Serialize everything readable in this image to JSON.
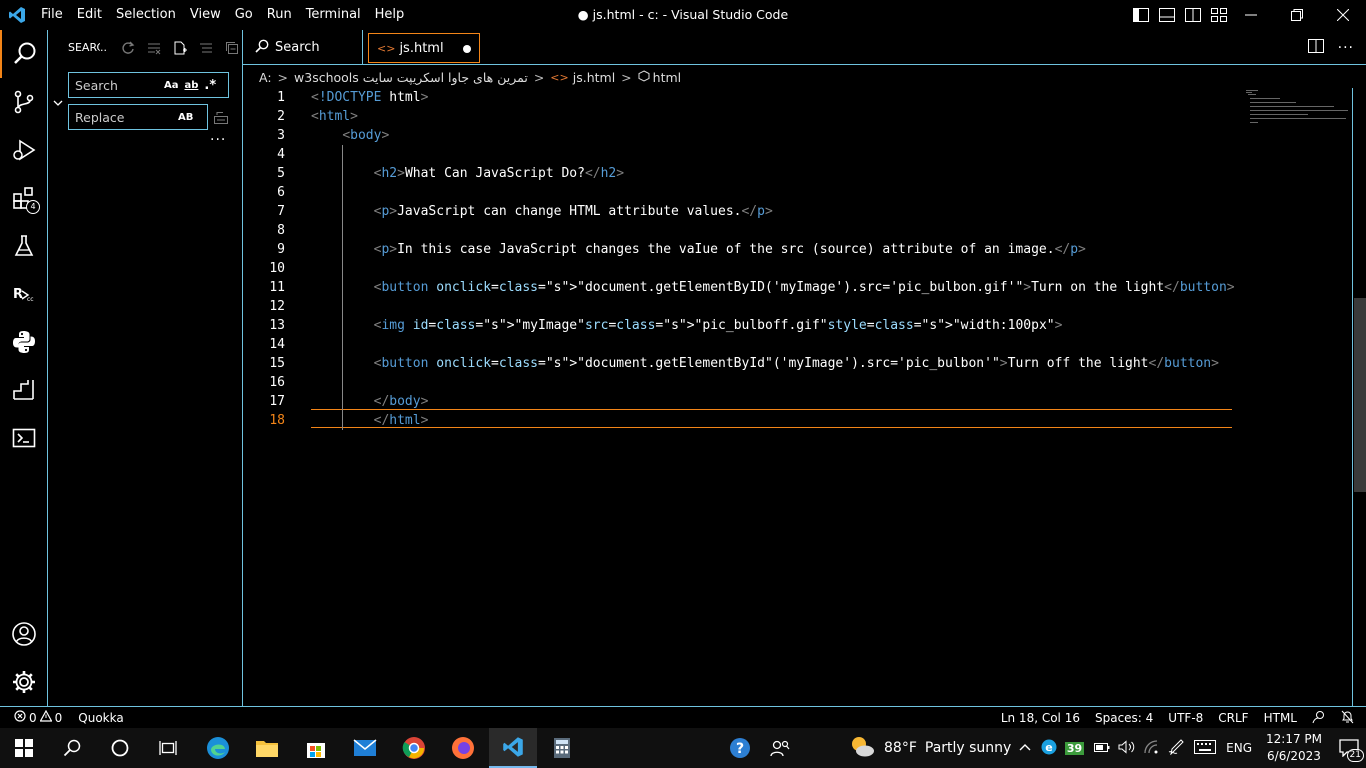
{
  "titlebar": {
    "menus": [
      "File",
      "Edit",
      "Selection",
      "View",
      "Go",
      "Run",
      "Terminal",
      "Help"
    ],
    "title": "● js.html - c: - Visual Studio Code"
  },
  "activity": {
    "extensions_badge": "4"
  },
  "sidebar": {
    "title": "SEARCH",
    "search_placeholder": "Search",
    "replace_placeholder": "Replace",
    "opt_case": "Aa",
    "opt_word": "ab",
    "opt_regex": ".*",
    "opt_preserve_case": "AB",
    "more": "..."
  },
  "tabs": [
    {
      "label": "Search",
      "icon": "search-icon"
    },
    {
      "label": "js.html",
      "icon": "html-file-icon",
      "dirty": true
    }
  ],
  "breadcrumb": {
    "drive": "A:",
    "folder": "تمرین های جاوا اسکریپت سایت w3schools",
    "file": "js.html",
    "symbol": "html"
  },
  "editor": {
    "current_line": 18,
    "lines": [
      {
        "n": "1",
        "code": "<!DOCTYPE html>"
      },
      {
        "n": "2",
        "code": "<html>"
      },
      {
        "n": "3",
        "code": "    <body>"
      },
      {
        "n": "4",
        "code": ""
      },
      {
        "n": "5",
        "code": "        <h2>What Can JavaScript Do?</h2>"
      },
      {
        "n": "6",
        "code": ""
      },
      {
        "n": "7",
        "code": "        <p>JavaScript can change HTML attribute values.</p>"
      },
      {
        "n": "8",
        "code": ""
      },
      {
        "n": "9",
        "code": "        <p>In this case JavaScript changes the vaIue of the src (source) attribute of an image.</p>"
      },
      {
        "n": "10",
        "code": ""
      },
      {
        "n": "11",
        "code": "        <button onclick=\"document.getElementByID('myImage').src='pic_bulbon.gif'\">Turn on the light</button>"
      },
      {
        "n": "12",
        "code": ""
      },
      {
        "n": "13",
        "code": "        <img id=\"myImage\"src=\"pic_bulboff.gif\"style=\"width:100px\">"
      },
      {
        "n": "14",
        "code": ""
      },
      {
        "n": "15",
        "code": "        <button onclick=\"document.getElementById\"('myImage').src='pic_bulbon'\">Turn off the light</button>"
      },
      {
        "n": "16",
        "code": ""
      },
      {
        "n": "17",
        "code": "        </body>"
      },
      {
        "n": "18",
        "code": "        </html>"
      }
    ]
  },
  "statusbar": {
    "errors": "0",
    "warnings": "0",
    "quokka": "Quokka",
    "position": "Ln 18, Col 16",
    "spaces": "Spaces: 4",
    "encoding": "UTF-8",
    "eol": "CRLF",
    "language": "HTML"
  },
  "taskbar": {
    "weather_temp": "88°F",
    "weather_desc": "Partly sunny",
    "lang": "ENG",
    "time": "12:17 PM",
    "date": "6/6/2023",
    "notifications": "21",
    "tray_badge": "39"
  }
}
